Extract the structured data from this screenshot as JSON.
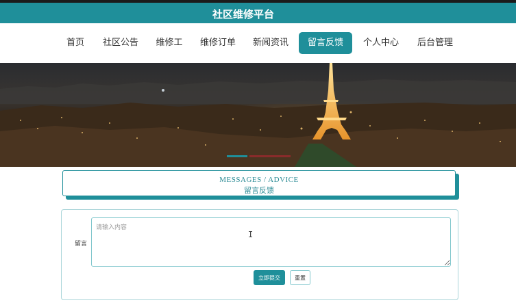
{
  "header": {
    "title": "社区维修平台"
  },
  "nav": {
    "items": [
      {
        "label": "首页"
      },
      {
        "label": "社区公告"
      },
      {
        "label": "维修工"
      },
      {
        "label": "维修订单"
      },
      {
        "label": "新闻资讯"
      },
      {
        "label": "留言反馈",
        "active": true
      },
      {
        "label": "个人中心"
      },
      {
        "label": "后台管理"
      }
    ]
  },
  "banner": {
    "active_slide": 1,
    "slide_count": 2
  },
  "section": {
    "title_en": "MESSAGES / ADVICE",
    "title_cn": "留言反馈"
  },
  "form": {
    "message_label": "留言",
    "message_value": "",
    "message_placeholder": "请输入内容",
    "submit_label": "立即提交",
    "reset_label": "重置"
  },
  "colors": {
    "accent": "#1f8f9a",
    "top_border": "#1b1b1b"
  },
  "icons": {
    "text_cursor": "I-beam-cursor-icon"
  }
}
